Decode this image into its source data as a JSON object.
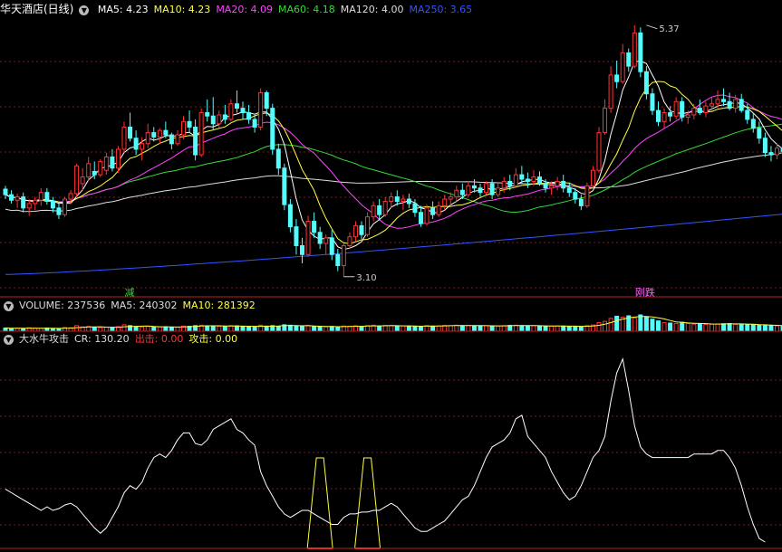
{
  "main_panel": {
    "stock_title": "华天酒店(日线)",
    "indicators": [
      {
        "label": "MA5: 4.23",
        "color": "#ffffff"
      },
      {
        "label": "MA10: 4.23",
        "color": "#ffff44"
      },
      {
        "label": "MA20: 4.09",
        "color": "#ff44ff"
      },
      {
        "label": "MA60: 4.18",
        "color": "#33dd33"
      },
      {
        "label": "MA120: 4.00",
        "color": "#dddddd"
      },
      {
        "label": "MA250: 3.65",
        "color": "#3355ff"
      }
    ],
    "signals": [
      {
        "text": "减",
        "color": "#33dd33",
        "index": 21
      },
      {
        "text": "刚跌",
        "color": "#ff66ff",
        "index": 107
      }
    ]
  },
  "volume_panel": {
    "labels": [
      {
        "text": "VOLUME: 237536",
        "color": "#dddddd"
      },
      {
        "text": "MA5: 240302",
        "color": "#dddddd"
      },
      {
        "text": "MA10: 281392",
        "color": "#ffff44"
      }
    ]
  },
  "indicator_panel": {
    "labels": [
      {
        "text": "大水牛攻击",
        "color": "#dddddd"
      },
      {
        "text": "CR: 130.20",
        "color": "#dddddd"
      },
      {
        "text": "出击: 0.00",
        "color": "#ff3333"
      },
      {
        "text": "攻击: 0.00",
        "color": "#ffff44"
      }
    ]
  },
  "chart_data": [
    {
      "type": "candlestick",
      "title": "华天酒店(日线)",
      "ylim": [
        3.0,
        5.45
      ],
      "annotations": [
        {
          "text": "5.37",
          "value": 5.37,
          "index": 108
        },
        {
          "text": "3.10",
          "value": 3.1,
          "index": 57
        }
      ],
      "colors": {
        "up": "#ff3232",
        "down": "#54fcfc"
      },
      "ohlc": [
        [
          3.89,
          3.92,
          3.8,
          3.84
        ],
        [
          3.84,
          3.88,
          3.76,
          3.79
        ],
        [
          3.79,
          3.85,
          3.72,
          3.82
        ],
        [
          3.82,
          3.86,
          3.68,
          3.72
        ],
        [
          3.72,
          3.8,
          3.65,
          3.76
        ],
        [
          3.76,
          3.82,
          3.7,
          3.79
        ],
        [
          3.79,
          3.9,
          3.74,
          3.86
        ],
        [
          3.86,
          3.9,
          3.75,
          3.78
        ],
        [
          3.78,
          3.82,
          3.68,
          3.72
        ],
        [
          3.72,
          3.76,
          3.62,
          3.66
        ],
        [
          3.66,
          3.82,
          3.64,
          3.8
        ],
        [
          3.8,
          3.88,
          3.76,
          3.85
        ],
        [
          3.85,
          4.12,
          3.82,
          4.1
        ],
        [
          3.94,
          4.08,
          3.88,
          4.0
        ],
        [
          4.0,
          4.18,
          3.96,
          4.12
        ],
        [
          4.05,
          4.14,
          3.98,
          4.02
        ],
        [
          4.02,
          4.16,
          4.0,
          4.14
        ],
        [
          4.06,
          4.22,
          4.02,
          4.18
        ],
        [
          4.18,
          4.25,
          4.05,
          4.08
        ],
        [
          4.08,
          4.28,
          4.04,
          4.25
        ],
        [
          4.25,
          4.5,
          4.22,
          4.45
        ],
        [
          4.45,
          4.58,
          4.32,
          4.35
        ],
        [
          4.35,
          4.42,
          4.2,
          4.25
        ],
        [
          4.25,
          4.36,
          4.15,
          4.3
        ],
        [
          4.3,
          4.48,
          4.26,
          4.4
        ],
        [
          4.4,
          4.45,
          4.32,
          4.36
        ],
        [
          4.36,
          4.44,
          4.3,
          4.42
        ],
        [
          4.42,
          4.5,
          4.35,
          4.38
        ],
        [
          4.38,
          4.4,
          4.25,
          4.3
        ],
        [
          4.3,
          4.42,
          4.28,
          4.38
        ],
        [
          4.38,
          4.55,
          4.34,
          4.5
        ],
        [
          4.5,
          4.6,
          4.4,
          4.45
        ],
        [
          4.45,
          4.52,
          4.15,
          4.2
        ],
        [
          4.2,
          4.62,
          4.18,
          4.58
        ],
        [
          4.58,
          4.7,
          4.5,
          4.55
        ],
        [
          4.55,
          4.72,
          4.42,
          4.48
        ],
        [
          4.48,
          4.6,
          4.44,
          4.56
        ],
        [
          4.56,
          4.65,
          4.48,
          4.52
        ],
        [
          4.52,
          4.7,
          4.5,
          4.66
        ],
        [
          4.66,
          4.78,
          4.58,
          4.62
        ],
        [
          4.62,
          4.68,
          4.52,
          4.58
        ],
        [
          4.58,
          4.65,
          4.48,
          4.52
        ],
        [
          4.52,
          4.56,
          4.4,
          4.45
        ],
        [
          4.45,
          4.8,
          4.42,
          4.76
        ],
        [
          4.76,
          4.78,
          4.55,
          4.62
        ],
        [
          4.62,
          4.66,
          4.2,
          4.25
        ],
        [
          4.25,
          4.3,
          4.02,
          4.08
        ],
        [
          4.08,
          4.12,
          3.7,
          3.75
        ],
        [
          3.75,
          3.8,
          3.5,
          3.55
        ],
        [
          3.55,
          3.62,
          3.3,
          3.38
        ],
        [
          3.38,
          3.45,
          3.22,
          3.3
        ],
        [
          3.3,
          3.65,
          3.28,
          3.6
        ],
        [
          3.6,
          3.68,
          3.45,
          3.5
        ],
        [
          3.5,
          3.55,
          3.35,
          3.4
        ],
        [
          3.4,
          3.48,
          3.3,
          3.45
        ],
        [
          3.45,
          3.52,
          3.25,
          3.3
        ],
        [
          3.3,
          3.35,
          3.15,
          3.2
        ],
        [
          3.2,
          3.4,
          3.1,
          3.38
        ],
        [
          3.38,
          3.5,
          3.35,
          3.46
        ],
        [
          3.46,
          3.6,
          3.42,
          3.56
        ],
        [
          3.56,
          3.6,
          3.44,
          3.48
        ],
        [
          3.48,
          3.68,
          3.46,
          3.64
        ],
        [
          3.64,
          3.78,
          3.6,
          3.74
        ],
        [
          3.74,
          3.8,
          3.62,
          3.66
        ],
        [
          3.66,
          3.82,
          3.64,
          3.78
        ],
        [
          3.78,
          3.86,
          3.72,
          3.82
        ],
        [
          3.82,
          3.88,
          3.74,
          3.78
        ],
        [
          3.78,
          3.84,
          3.7,
          3.8
        ],
        [
          3.8,
          3.85,
          3.72,
          3.76
        ],
        [
          3.76,
          3.8,
          3.64,
          3.68
        ],
        [
          3.68,
          3.74,
          3.55,
          3.58
        ],
        [
          3.58,
          3.75,
          3.56,
          3.72
        ],
        [
          3.72,
          3.78,
          3.62,
          3.66
        ],
        [
          3.66,
          3.78,
          3.64,
          3.74
        ],
        [
          3.74,
          3.84,
          3.7,
          3.8
        ],
        [
          3.8,
          3.86,
          3.74,
          3.82
        ],
        [
          3.82,
          3.92,
          3.78,
          3.88
        ],
        [
          3.88,
          3.94,
          3.8,
          3.84
        ],
        [
          3.84,
          3.96,
          3.82,
          3.92
        ],
        [
          3.92,
          3.98,
          3.86,
          3.9
        ],
        [
          3.9,
          3.94,
          3.82,
          3.86
        ],
        [
          3.86,
          3.96,
          3.84,
          3.94
        ],
        [
          3.94,
          3.98,
          3.8,
          3.84
        ],
        [
          3.84,
          3.94,
          3.82,
          3.9
        ],
        [
          3.9,
          4.0,
          3.86,
          3.96
        ],
        [
          3.96,
          4.02,
          3.88,
          3.92
        ],
        [
          3.92,
          4.08,
          3.9,
          4.02
        ],
        [
          4.02,
          4.1,
          3.94,
          3.98
        ],
        [
          3.98,
          4.04,
          3.9,
          3.96
        ],
        [
          3.96,
          4.06,
          3.92,
          4.0
        ],
        [
          4.0,
          4.05,
          3.92,
          3.94
        ],
        [
          3.94,
          3.98,
          3.86,
          3.9
        ],
        [
          3.9,
          3.96,
          3.84,
          3.92
        ],
        [
          3.92,
          4.0,
          3.88,
          3.96
        ],
        [
          3.96,
          4.02,
          3.86,
          3.9
        ],
        [
          3.9,
          3.95,
          3.82,
          3.86
        ],
        [
          3.86,
          3.9,
          3.76,
          3.8
        ],
        [
          3.8,
          3.84,
          3.7,
          3.74
        ],
        [
          3.74,
          3.95,
          3.72,
          3.92
        ],
        [
          3.92,
          4.1,
          3.9,
          4.06
        ],
        [
          4.06,
          4.45,
          4.04,
          4.4
        ],
        [
          4.4,
          4.7,
          4.38,
          4.62
        ],
        [
          4.62,
          5.0,
          4.58,
          4.92
        ],
        [
          4.92,
          5.05,
          4.8,
          4.86
        ],
        [
          4.86,
          5.2,
          4.84,
          5.12
        ],
        [
          5.12,
          5.16,
          4.95,
          5.0
        ],
        [
          5.0,
          5.37,
          4.98,
          5.3
        ],
        [
          5.3,
          5.35,
          4.9,
          4.95
        ],
        [
          4.95,
          5.0,
          4.7,
          4.75
        ],
        [
          4.75,
          4.8,
          4.56,
          4.6
        ],
        [
          4.6,
          4.68,
          4.46,
          4.5
        ],
        [
          4.5,
          4.62,
          4.44,
          4.58
        ],
        [
          4.58,
          4.64,
          4.5,
          4.55
        ],
        [
          4.55,
          4.72,
          4.52,
          4.68
        ],
        [
          4.68,
          4.72,
          4.5,
          4.54
        ],
        [
          4.54,
          4.6,
          4.48,
          4.56
        ],
        [
          4.56,
          4.66,
          4.52,
          4.62
        ],
        [
          4.62,
          4.7,
          4.56,
          4.58
        ],
        [
          4.58,
          4.68,
          4.54,
          4.64
        ],
        [
          4.64,
          4.72,
          4.6,
          4.66
        ],
        [
          4.66,
          4.78,
          4.62,
          4.7
        ],
        [
          4.7,
          4.8,
          4.64,
          4.68
        ],
        [
          4.68,
          4.76,
          4.6,
          4.62
        ],
        [
          4.62,
          4.74,
          4.58,
          4.7
        ],
        [
          4.7,
          4.75,
          4.58,
          4.6
        ],
        [
          4.6,
          4.66,
          4.48,
          4.52
        ],
        [
          4.52,
          4.58,
          4.4,
          4.44
        ],
        [
          4.44,
          4.5,
          4.3,
          4.35
        ],
        [
          4.35,
          4.4,
          4.18,
          4.22
        ],
        [
          4.22,
          4.28,
          4.14,
          4.2
        ],
        [
          4.2,
          4.3,
          4.16,
          4.26
        ],
        [
          4.26,
          4.32,
          4.18,
          4.23
        ],
        [
          4.23,
          4.28,
          4.1,
          4.15
        ]
      ]
    },
    {
      "type": "bar",
      "title": "VOLUME",
      "values": [
        150,
        130,
        140,
        120,
        160,
        140,
        130,
        150,
        120,
        110,
        170,
        160,
        260,
        200,
        220,
        180,
        170,
        190,
        160,
        210,
        300,
        260,
        210,
        200,
        230,
        190,
        200,
        210,
        180,
        190,
        240,
        230,
        260,
        280,
        250,
        240,
        230,
        220,
        260,
        250,
        220,
        210,
        200,
        280,
        240,
        260,
        230,
        300,
        280,
        240,
        220,
        260,
        230,
        210,
        200,
        220,
        200,
        240,
        230,
        250,
        220,
        260,
        280,
        240,
        270,
        260,
        230,
        250,
        240,
        220,
        230,
        260,
        240,
        250,
        270,
        260,
        280,
        260,
        270,
        250,
        240,
        260,
        250,
        240,
        260,
        270,
        280,
        260,
        250,
        260,
        240,
        230,
        240,
        250,
        240,
        230,
        220,
        210,
        260,
        290,
        400,
        460,
        600,
        700,
        650,
        720,
        620,
        760,
        680,
        560,
        480,
        400,
        380,
        360,
        420,
        360,
        330,
        340,
        320,
        330,
        340,
        350,
        360,
        320,
        330,
        310,
        300,
        290,
        270,
        260,
        250,
        245,
        240
      ],
      "ma5": 240302,
      "ma10": 281392
    },
    {
      "type": "line",
      "title": "大水牛攻击",
      "cr_values": [
        30,
        28,
        26,
        24,
        22,
        20,
        18,
        20,
        18,
        19,
        21,
        22,
        20,
        16,
        12,
        8,
        5,
        8,
        14,
        20,
        28,
        32,
        30,
        34,
        42,
        48,
        50,
        48,
        52,
        58,
        62,
        62,
        56,
        55,
        58,
        64,
        66,
        68,
        70,
        64,
        62,
        58,
        55,
        40,
        32,
        26,
        20,
        16,
        14,
        16,
        18,
        18,
        16,
        14,
        12,
        10,
        10,
        14,
        16,
        16,
        17,
        17,
        18,
        18,
        20,
        22,
        20,
        16,
        12,
        8,
        6,
        6,
        8,
        10,
        12,
        16,
        20,
        24,
        26,
        32,
        40,
        48,
        54,
        56,
        58,
        62,
        70,
        72,
        60,
        56,
        52,
        48,
        40,
        34,
        28,
        24,
        26,
        32,
        40,
        48,
        52,
        60,
        80,
        96,
        104,
        86,
        66,
        54,
        50,
        48,
        48,
        48,
        48,
        48,
        48,
        48,
        50,
        50,
        50,
        50,
        52,
        52,
        48,
        42,
        32,
        20,
        10,
        2,
        0
      ],
      "attack_values": [
        0,
        0,
        0,
        0,
        0,
        0,
        0,
        0,
        0,
        0,
        0,
        0,
        0,
        0,
        0,
        0,
        0,
        0,
        0,
        0,
        0,
        0,
        0,
        0,
        0,
        0,
        0,
        0,
        0,
        0,
        0,
        0,
        0,
        0,
        0,
        0,
        0,
        0,
        0,
        0,
        0,
        0,
        0,
        0,
        0,
        0,
        0,
        0,
        0,
        0,
        0,
        0,
        0,
        100,
        0,
        0,
        0,
        0,
        0,
        0,
        0,
        100,
        0,
        0,
        0,
        0,
        0,
        0,
        0,
        0,
        0,
        0,
        0,
        0,
        0,
        0,
        0,
        0,
        0,
        0,
        0,
        0,
        0,
        0,
        0,
        0,
        0,
        0,
        0,
        0,
        0,
        0,
        0,
        0,
        0,
        0,
        0,
        0,
        0,
        0,
        0,
        0,
        0,
        0,
        0,
        0,
        0,
        0,
        0,
        0,
        0,
        0,
        0,
        0,
        0,
        0,
        0,
        0,
        0,
        0,
        0,
        0,
        0,
        0,
        0,
        0,
        0,
        0,
        0
      ]
    }
  ]
}
